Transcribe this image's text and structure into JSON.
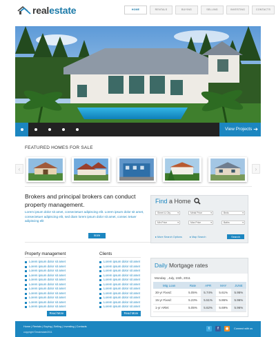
{
  "header": {
    "logo_text": "realestate",
    "nav": [
      "HOME",
      "RENTALS",
      "BUYING",
      "SELLING",
      "INVESTING",
      "CONTACTS"
    ],
    "active_nav": "HOME"
  },
  "hero": {
    "view_projects": "View Projects",
    "slide_count": 5,
    "active_slide": 1
  },
  "featured": {
    "title": "FEATURED HOMES FOR SALE",
    "thumbnails": 5
  },
  "intro": {
    "heading": "Brokers and principal brokers can conduct property management.",
    "body": "Lorem ipsum dolor sit amet, consectetuer adipiscing elit. Lorem ipsum dolor sit amet, consectetuer adipiscing elit, sed diam lorem ipsum dolor sit amet, consec tetuer adipiscing elit",
    "more": "more"
  },
  "find": {
    "title_a": "Find",
    "title_b": "a Home",
    "selects": [
      "Street & City",
      "Metal Price",
      "Beds",
      "Min Price",
      "Max Price",
      "Baths"
    ],
    "options_link": "More Search Options",
    "map_link": "Map Search",
    "search": "Search"
  },
  "property": {
    "title": "Property management",
    "items": [
      "Lorem ipsum dolor sit amet",
      "Lorem ipsum dolor sit amet",
      "Lorem ipsum dolor sit amet",
      "Lorem ipsum dolor sit amet",
      "Lorem ipsum dolor sit amet",
      "Lorem ipsum dolor sit amet",
      "Lorem ipsum dolor sit amet",
      "Lorem ipsum dolor sit amet",
      "Lorem ipsum dolor sit amet",
      "Lorem ipsum dolor sit amet",
      "Lorem ipsum dolor sit amet"
    ],
    "more": "Read More"
  },
  "clients": {
    "title": "Clients",
    "items": [
      "Lorem ipsum dolor sit amet",
      "Lorem ipsum dolor sit amet",
      "Lorem ipsum dolor sit amet",
      "Lorem ipsum dolor sit amet",
      "Lorem ipsum dolor sit amet",
      "Lorem ipsum dolor sit amet",
      "Lorem ipsum dolor sit amet",
      "Lorem ipsum dolor sit amet",
      "Lorem ipsum dolor sit amet",
      "Lorem ipsum dolor sit amet",
      "Lorem ipsum dolor sit amet"
    ],
    "more": "Read More"
  },
  "mortgage": {
    "title_a": "Daily",
    "title_b": "Mortgage rates",
    "date": "Monday , July, 15th, 2011",
    "headers": [
      "Mtg Loan",
      "Rate",
      "APR",
      "MAY",
      "JUNE"
    ],
    "rows": [
      [
        "30-yr Fixed:",
        "5.05%",
        "5.74%",
        "5.61%",
        "5.95%"
      ],
      [
        "15-yr Fixed:",
        "5.23%",
        "5.51%",
        "5.86%",
        "5.96%"
      ],
      [
        "1-yr ARM:",
        "5.05%",
        "5.62%",
        "5.69%",
        "5.96%"
      ]
    ]
  },
  "footer": {
    "links": "Home  |  Rentals  |  Buying  |  Selling  |  Investing  |  Contacts",
    "copyright": "copyright ©realestate2011",
    "connect": "Connect with us",
    "accent": "#1c86c0"
  }
}
